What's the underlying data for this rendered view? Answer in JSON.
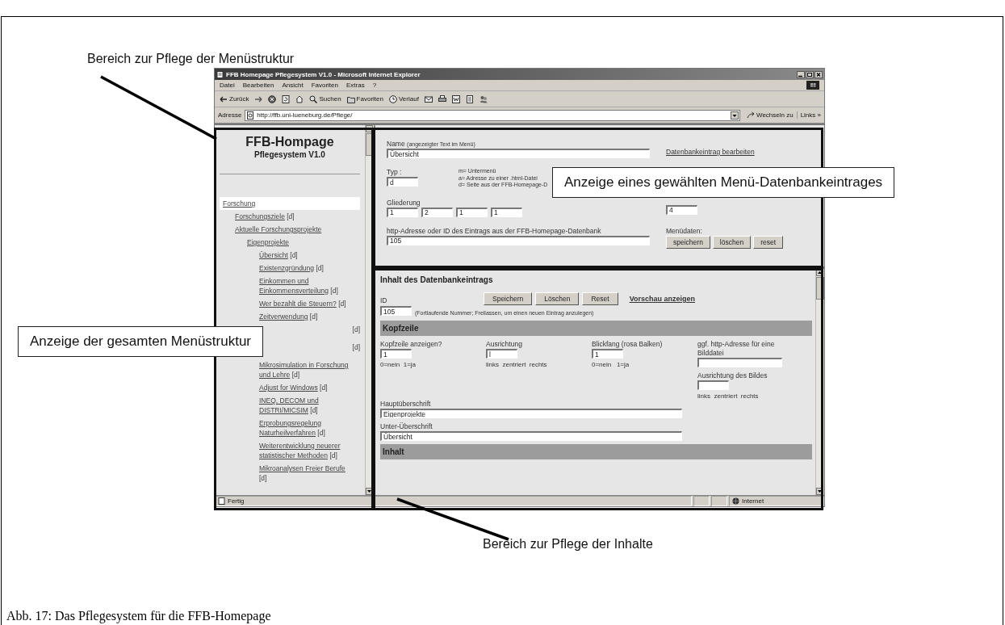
{
  "figure": {
    "caption": "Abb. 17: Das Pflegesystem für die FFB-Homepage",
    "annotations": [
      {
        "kind": "label",
        "text": "Bereich zur Pflege der Menüstruktur"
      },
      {
        "kind": "box",
        "text": "Anzeige eines gewählten Menü-Datenbankeintrages"
      },
      {
        "kind": "box",
        "text": "Anzeige der gesamten Menüstruktur"
      },
      {
        "kind": "label",
        "text": "Bereich zur Pflege der Inhalte"
      }
    ]
  },
  "window": {
    "title": "FFB Homepage Pflegesystem V1.0 - Microsoft Internet Explorer",
    "menu": [
      "Datei",
      "Bearbeiten",
      "Ansicht",
      "Favoriten",
      "Extras",
      "?"
    ],
    "toolbar": [
      {
        "kind": "back",
        "label": "Zurück"
      },
      {
        "kind": "forward"
      },
      {
        "kind": "stop"
      },
      {
        "kind": "refresh"
      },
      {
        "kind": "home"
      },
      {
        "kind": "search",
        "label": "Suchen"
      },
      {
        "kind": "favorites",
        "label": "Favoriten"
      },
      {
        "kind": "history",
        "label": "Verlauf"
      },
      {
        "kind": "mail"
      },
      {
        "kind": "print"
      },
      {
        "kind": "edit"
      },
      {
        "kind": "discuss"
      },
      {
        "kind": "messenger"
      }
    ],
    "address_label": "Adresse",
    "address": "http://ffb.uni-lueneburg.de/Pflege/",
    "go": "Wechseln zu",
    "links": "Links »"
  },
  "menu_frame": {
    "title": "FFB-Hompage",
    "subtitle": "Pflegesystem V1.0",
    "items": [
      {
        "label": "Forschung",
        "selected": true,
        "children": [
          {
            "label": "Forschungsziele",
            "tag": "[d]",
            "selected": false
          },
          {
            "label": "Aktuelle Forschungsprojekte",
            "selected": false,
            "children": [
              {
                "label": "Eigenprojekte",
                "selected": false,
                "children": [
                  {
                    "label": "Übersicht",
                    "tag": "[d]",
                    "selected": false
                  },
                  {
                    "label": "Existenzgründung",
                    "tag": "[d]",
                    "selected": false
                  },
                  {
                    "label": "Einkommen und Einkommensverteilung",
                    "tag": "[d]",
                    "selected": false
                  },
                  {
                    "label": "Wer bezahlt die Steuern?",
                    "tag": "[d]",
                    "selected": false
                  },
                  {
                    "label": "Zeitverwendung",
                    "tag": "[d]",
                    "selected": false
                  },
                  {
                    "tag": "[d]",
                    "selected": false
                  },
                  {
                    "tag": "[d]",
                    "selected": false
                  },
                  {
                    "label": "Mikrosimulation in Forschung und Lehre",
                    "tag": "[d]",
                    "selected": false
                  },
                  {
                    "label": "Adjust for Windows",
                    "tag": "[d]",
                    "selected": false
                  },
                  {
                    "label": "INEQ, DECOM und DISTRI/MICSIM",
                    "tag": "[d]",
                    "selected": false
                  },
                  {
                    "label": "Erprobungsregelung Naturheilverfahren",
                    "tag": "[d]",
                    "selected": false
                  },
                  {
                    "label": "Weiterentwicklung neuerer statistischer Methoden",
                    "tag": "[d]",
                    "selected": false
                  },
                  {
                    "label": "Mikroanalysen Freier Berufe",
                    "tag": "[d]",
                    "selected": false
                  }
                ]
              }
            ]
          }
        ]
      }
    ]
  },
  "entry_form": {
    "name_label": "Name",
    "name_hint": "(angezeigter Text im Menü)",
    "name": "Übersicht",
    "edit_link": "Datenbankeintrag bearbeiten",
    "type_label": "Typ :",
    "type": "d",
    "type_legend": [
      "m= Untermenü",
      "a= Adresse zu einer .html-Datei",
      "d= Seite aus der FFB-Homepage-D"
    ],
    "outline_label": "Gliederung",
    "outline": [
      "1",
      "2",
      "1",
      "1"
    ],
    "level_value": "4",
    "address_label": "http-Adresse oder ID des Eintrags aus der FFB-Homepage-Datenbank",
    "address": "105",
    "buttons_label": "Menüdaten:",
    "buttons": [
      "speichern",
      "löschen",
      "reset"
    ]
  },
  "content_form": {
    "heading": "Inhalt des Datenbankeintrags",
    "id_label": "ID",
    "id": "105",
    "id_note": "(Fortlaufende Nummer; Freilassen, um einen neuen Eintrag anzulegen)",
    "buttons": [
      "Speichern",
      "Löschen",
      "Reset"
    ],
    "preview_link": "Vorschau anzeigen",
    "section_1": "Kopfzeile",
    "fields": [
      {
        "kind": "code",
        "label": "Kopfzeile anzeigen?",
        "value": "1",
        "hint": "0=nein  1=ja"
      },
      {
        "kind": "code",
        "label": "Ausrichtung",
        "value": "l",
        "hint": "links  zentriert  rechts"
      },
      {
        "kind": "code",
        "label": "Blickfang (rosa Balken)",
        "value": "1",
        "hint": "0=nein   1=ja"
      },
      {
        "kind": "image",
        "label": "ggf. http-Adresse für eine Bilddatei",
        "sub_label": "Ausrichtung des Bildes",
        "sub_hint": "links  zentriert  rechts"
      }
    ],
    "main_heading_label": "Hauptüberschrift",
    "main_heading": "Eigenprojekte",
    "sub_heading_label": "Unter-Überschrift",
    "sub_heading": "Übersicht",
    "section_2": "Inhalt"
  },
  "status_bar": {
    "text": "Fertig",
    "zone": "Internet"
  }
}
